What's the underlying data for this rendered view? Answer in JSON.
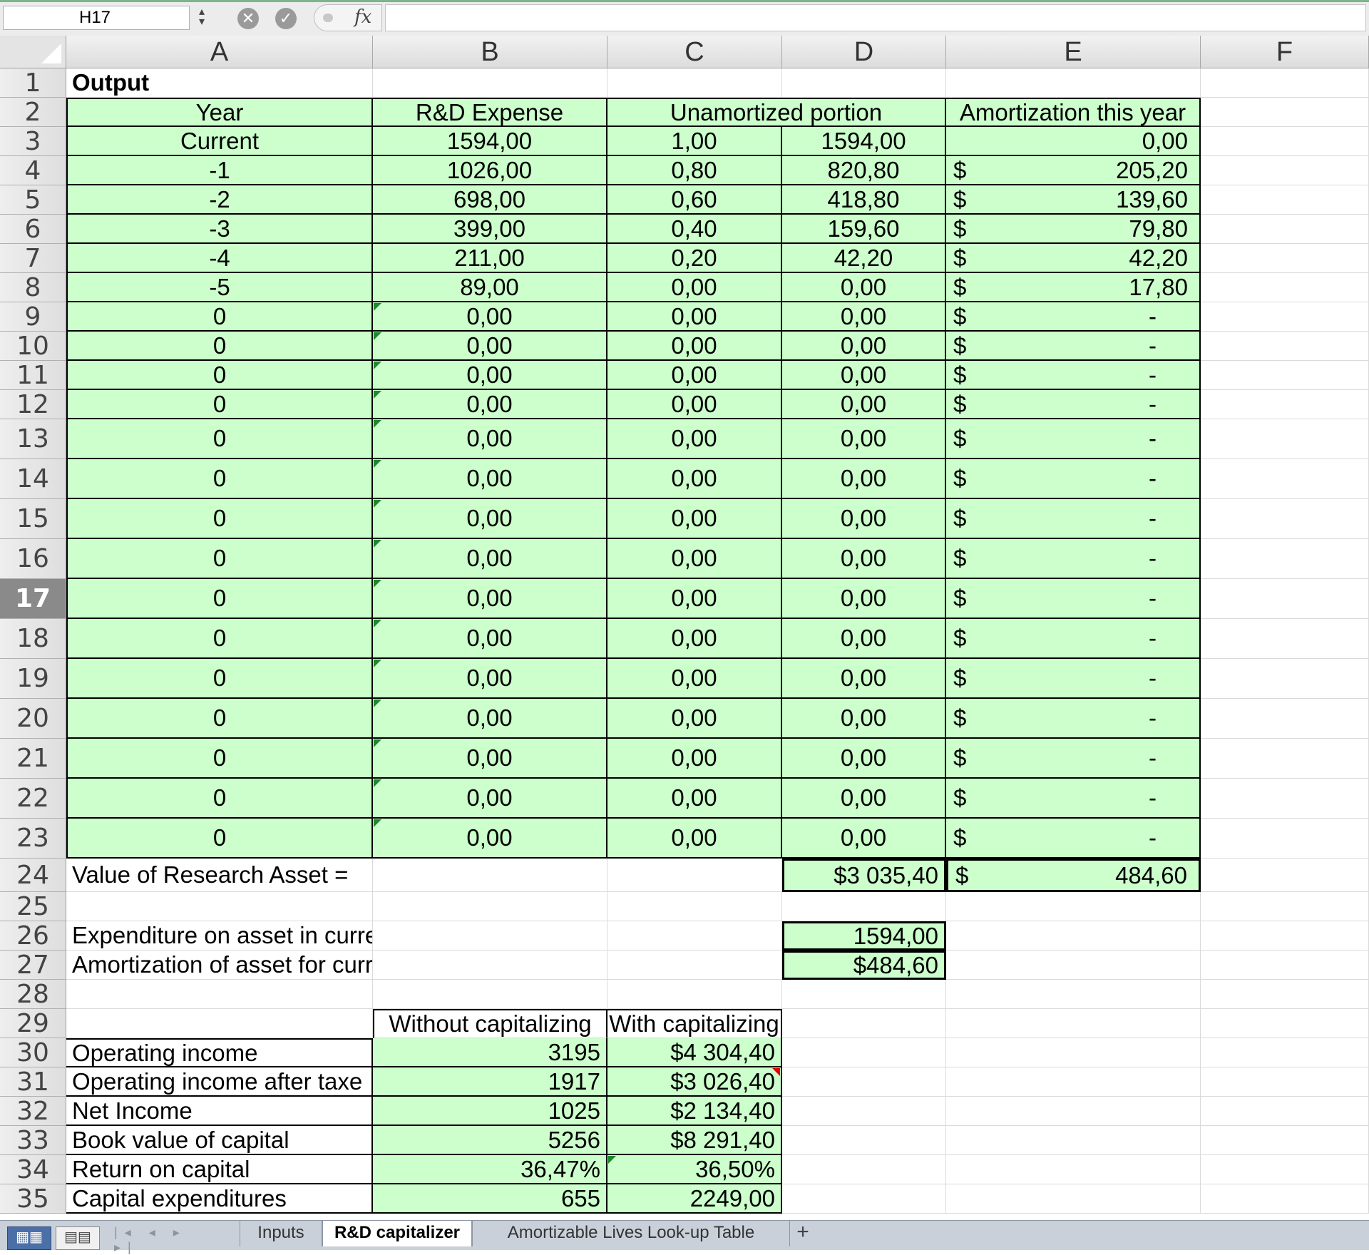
{
  "formula_bar": {
    "name_box": "H17",
    "fx_label": "fx",
    "formula": ""
  },
  "columns": [
    "A",
    "B",
    "C",
    "D",
    "E",
    "F"
  ],
  "rows": [
    "1",
    "2",
    "3",
    "4",
    "5",
    "6",
    "7",
    "8",
    "9",
    "10",
    "11",
    "12",
    "13",
    "14",
    "15",
    "16",
    "17",
    "18",
    "19",
    "20",
    "21",
    "22",
    "23",
    "24",
    "25",
    "26",
    "27",
    "28",
    "29",
    "30",
    "31",
    "32",
    "33",
    "34",
    "35"
  ],
  "active_row": "17",
  "output_title": "Output",
  "table_header": {
    "year": "Year",
    "rd_expense": "R&D Expense",
    "unamortized": "Unamortized portion",
    "amortization": "Amortization this year"
  },
  "currency_symbol": "$",
  "amort_rows": [
    {
      "year": "Current",
      "expense": "1594,00",
      "fraction": "1,00",
      "unamortized": "1594,00",
      "amort": "0,00",
      "dollar": ""
    },
    {
      "year": "-1",
      "expense": "1026,00",
      "fraction": "0,80",
      "unamortized": "820,80",
      "amort": "205,20",
      "dollar": "$"
    },
    {
      "year": "-2",
      "expense": "698,00",
      "fraction": "0,60",
      "unamortized": "418,80",
      "amort": "139,60",
      "dollar": "$"
    },
    {
      "year": "-3",
      "expense": "399,00",
      "fraction": "0,40",
      "unamortized": "159,60",
      "amort": "79,80",
      "dollar": "$"
    },
    {
      "year": "-4",
      "expense": "211,00",
      "fraction": "0,20",
      "unamortized": "42,20",
      "amort": "42,20",
      "dollar": "$"
    },
    {
      "year": "-5",
      "expense": "89,00",
      "fraction": "0,00",
      "unamortized": "0,00",
      "amort": "17,80",
      "dollar": "$"
    },
    {
      "year": "0",
      "expense": "0,00",
      "fraction": "0,00",
      "unamortized": "0,00",
      "amort": "-",
      "dollar": "$"
    },
    {
      "year": "0",
      "expense": "0,00",
      "fraction": "0,00",
      "unamortized": "0,00",
      "amort": "-",
      "dollar": "$"
    },
    {
      "year": "0",
      "expense": "0,00",
      "fraction": "0,00",
      "unamortized": "0,00",
      "amort": "-",
      "dollar": "$"
    },
    {
      "year": "0",
      "expense": "0,00",
      "fraction": "0,00",
      "unamortized": "0,00",
      "amort": "-",
      "dollar": "$"
    },
    {
      "year": "0",
      "expense": "0,00",
      "fraction": "0,00",
      "unamortized": "0,00",
      "amort": "-",
      "dollar": "$"
    },
    {
      "year": "0",
      "expense": "0,00",
      "fraction": "0,00",
      "unamortized": "0,00",
      "amort": "-",
      "dollar": "$"
    },
    {
      "year": "0",
      "expense": "0,00",
      "fraction": "0,00",
      "unamortized": "0,00",
      "amort": "-",
      "dollar": "$"
    },
    {
      "year": "0",
      "expense": "0,00",
      "fraction": "0,00",
      "unamortized": "0,00",
      "amort": "-",
      "dollar": "$"
    },
    {
      "year": "0",
      "expense": "0,00",
      "fraction": "0,00",
      "unamortized": "0,00",
      "amort": "-",
      "dollar": "$"
    },
    {
      "year": "0",
      "expense": "0,00",
      "fraction": "0,00",
      "unamortized": "0,00",
      "amort": "-",
      "dollar": "$"
    },
    {
      "year": "0",
      "expense": "0,00",
      "fraction": "0,00",
      "unamortized": "0,00",
      "amort": "-",
      "dollar": "$"
    },
    {
      "year": "0",
      "expense": "0,00",
      "fraction": "0,00",
      "unamortized": "0,00",
      "amort": "-",
      "dollar": "$"
    },
    {
      "year": "0",
      "expense": "0,00",
      "fraction": "0,00",
      "unamortized": "0,00",
      "amort": "-",
      "dollar": "$"
    },
    {
      "year": "0",
      "expense": "0,00",
      "fraction": "0,00",
      "unamortized": "0,00",
      "amort": "-",
      "dollar": "$"
    },
    {
      "year": "0",
      "expense": "0,00",
      "fraction": "0,00",
      "unamortized": "0,00",
      "amort": "-",
      "dollar": "$"
    }
  ],
  "research_asset": {
    "label": "Value of Research Asset =",
    "value": "$3 035,40",
    "amort_total": "484,60"
  },
  "expenditure": {
    "label": "Expenditure on asset in current year =",
    "value": "1594,00"
  },
  "amortization": {
    "label": "Amortization of asset for current year =",
    "value": "$484,60"
  },
  "comparison": {
    "header_without": "Without capitalizing",
    "header_with": "With capitalizing",
    "rows": [
      {
        "label": "Operating income",
        "without": "3195",
        "with": "$4 304,40"
      },
      {
        "label": "Operating income after taxe",
        "without": "1917",
        "with": "$3 026,40"
      },
      {
        "label": "Net Income",
        "without": "1025",
        "with": "$2 134,40"
      },
      {
        "label": "Book value of capital",
        "without": "5256",
        "with": "$8 291,40"
      },
      {
        "label": "Return on capital",
        "without": "36,47%",
        "with": "36,50%"
      },
      {
        "label": "Capital expenditures",
        "without": "655",
        "with": "2249,00"
      }
    ]
  },
  "tab_bar": {
    "nav_arrows": "|◂ ◂ ▸ ▸|",
    "tabs": [
      "Inputs",
      "R&D capitalizer",
      "Amortizable Lives Look-up Table"
    ],
    "active_tab": "R&D capitalizer",
    "add_label": "+"
  },
  "colors": {
    "fill": "#ccffcc",
    "border": "#000000",
    "active_header": "#8a8a8a"
  }
}
